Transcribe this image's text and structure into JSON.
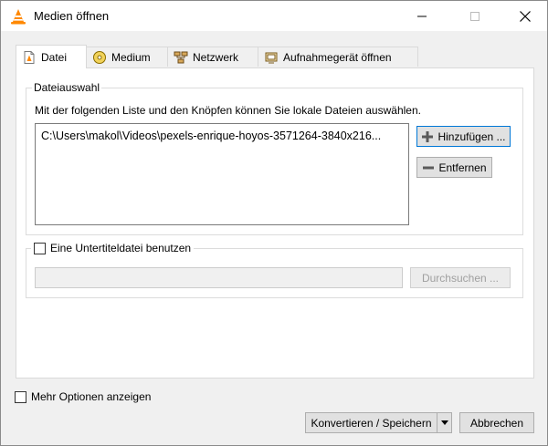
{
  "window": {
    "title": "Medien öffnen"
  },
  "tabs": [
    {
      "label": "Datei",
      "icon": "file-icon",
      "active": true
    },
    {
      "label": "Medium",
      "icon": "disc-icon",
      "active": false
    },
    {
      "label": "Netzwerk",
      "icon": "network-icon",
      "active": false
    },
    {
      "label": "Aufnahmegerät öffnen",
      "icon": "capture-device-icon",
      "active": false
    }
  ],
  "file_selection": {
    "group_title": "Dateiauswahl",
    "description": "Mit der folgenden Liste und den Knöpfen können Sie lokale Dateien auswählen.",
    "files": [
      "C:\\Users\\makol\\Videos\\pexels-enrique-hoyos-3571264-3840x216..."
    ],
    "add_label": "Hinzufügen ...",
    "remove_label": "Entfernen"
  },
  "subtitle": {
    "checkbox_label": "Eine Untertiteldatei benutzen",
    "checked": false,
    "path_value": "",
    "browse_label": "Durchsuchen ..."
  },
  "footer": {
    "more_options_label": "Mehr Optionen anzeigen",
    "convert_label": "Konvertieren / Speichern",
    "cancel_label": "Abbrechen"
  },
  "colors": {
    "accent": "#0078d7",
    "vlc_orange": "#ff8800"
  }
}
